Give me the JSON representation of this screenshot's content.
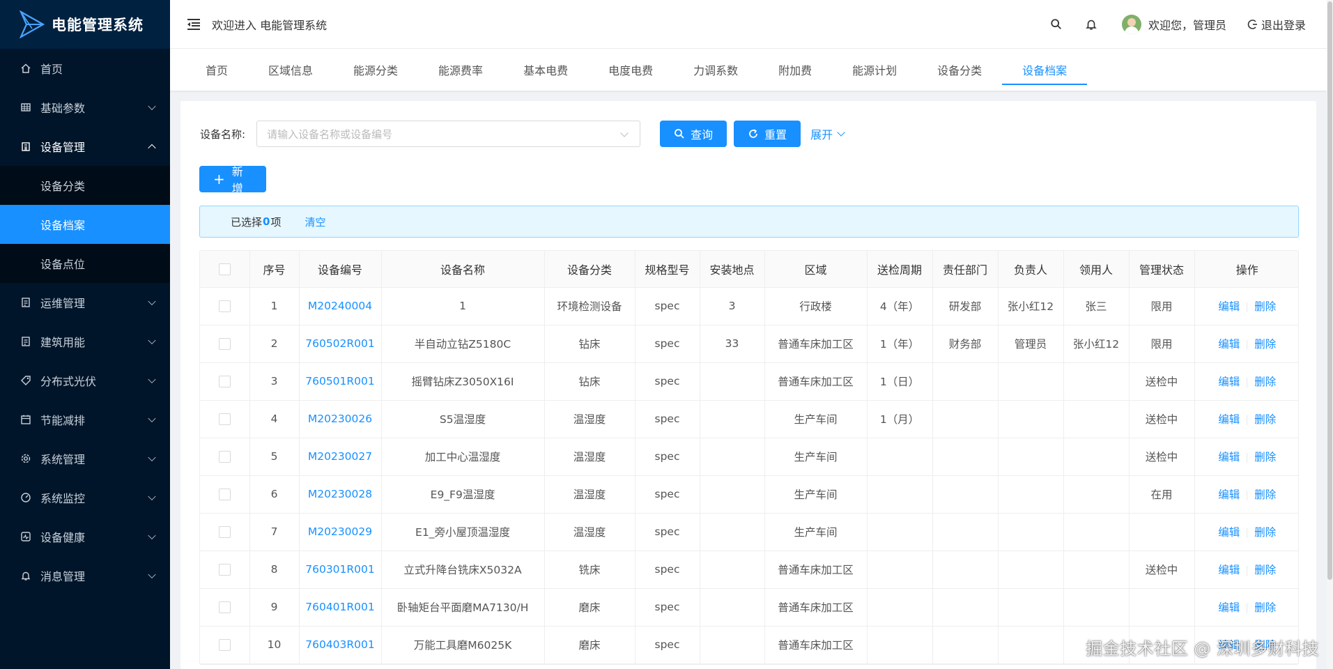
{
  "app": {
    "title": "电能管理系统"
  },
  "sidebar": {
    "items": [
      {
        "label": "首页",
        "icon": "home-icon",
        "has_children": false
      },
      {
        "label": "基础参数",
        "icon": "table-icon",
        "has_children": true
      },
      {
        "label": "设备管理",
        "icon": "building-icon",
        "has_children": true,
        "open": true,
        "children": [
          {
            "label": "设备分类",
            "active": false
          },
          {
            "label": "设备档案",
            "active": true
          },
          {
            "label": "设备点位",
            "active": false
          }
        ]
      },
      {
        "label": "运维管理",
        "icon": "clipboard-icon",
        "has_children": true
      },
      {
        "label": "建筑用能",
        "icon": "clipboard-icon",
        "has_children": true
      },
      {
        "label": "分布式光伏",
        "icon": "tag-icon",
        "has_children": true
      },
      {
        "label": "节能减排",
        "icon": "calendar-icon",
        "has_children": true
      },
      {
        "label": "系统管理",
        "icon": "gear-icon",
        "has_children": true
      },
      {
        "label": "系统监控",
        "icon": "dashboard-icon",
        "has_children": true
      },
      {
        "label": "设备健康",
        "icon": "health-icon",
        "has_children": true
      },
      {
        "label": "消息管理",
        "icon": "bell-icon",
        "has_children": true
      }
    ]
  },
  "header": {
    "welcome": "欢迎进入 电能管理系统",
    "user_greeting": "欢迎您，管理员",
    "logout": "退出登录"
  },
  "tabs": [
    {
      "label": "首页",
      "active": false
    },
    {
      "label": "区域信息",
      "active": false
    },
    {
      "label": "能源分类",
      "active": false
    },
    {
      "label": "能源费率",
      "active": false
    },
    {
      "label": "基本电费",
      "active": false
    },
    {
      "label": "电度电费",
      "active": false
    },
    {
      "label": "力调系数",
      "active": false
    },
    {
      "label": "附加费",
      "active": false
    },
    {
      "label": "能源计划",
      "active": false
    },
    {
      "label": "设备分类",
      "active": false
    },
    {
      "label": "设备档案",
      "active": true
    }
  ],
  "search": {
    "label": "设备名称:",
    "placeholder": "请输入设备名称或设备编号",
    "query": "查询",
    "reset": "重置",
    "expand": "展开"
  },
  "toolbar": {
    "add": "新增"
  },
  "selection": {
    "prefix": "已选择",
    "count": "0",
    "suffix": "项",
    "clear": "清空"
  },
  "table": {
    "columns": [
      "序号",
      "设备编号",
      "设备名称",
      "设备分类",
      "规格型号",
      "安装地点",
      "区域",
      "送检周期",
      "责任部门",
      "负责人",
      "领用人",
      "管理状态",
      "操作"
    ],
    "edit": "编辑",
    "delete": "删除",
    "rows": [
      {
        "no": "1",
        "code": "M20240004",
        "name": "1",
        "category": "环境检测设备",
        "spec": "spec",
        "location": "3",
        "area": "行政楼",
        "cycle": "4（年）",
        "dept": "研发部",
        "owner": "张小红12",
        "user": "张三",
        "status": "限用"
      },
      {
        "no": "2",
        "code": "760502R001",
        "name": "半自动立钻Z5180C",
        "category": "钻床",
        "spec": "spec",
        "location": "33",
        "area": "普通车床加工区",
        "cycle": "1（年）",
        "dept": "财务部",
        "owner": "管理员",
        "user": "张小红12",
        "status": "限用"
      },
      {
        "no": "3",
        "code": "760501R001",
        "name": "摇臂钻床Z3050X16I",
        "category": "钻床",
        "spec": "spec",
        "location": "",
        "area": "普通车床加工区",
        "cycle": "1（日）",
        "dept": "",
        "owner": "",
        "user": "",
        "status": "送检中"
      },
      {
        "no": "4",
        "code": "M20230026",
        "name": "S5温湿度",
        "category": "温湿度",
        "spec": "spec",
        "location": "",
        "area": "生产车间",
        "cycle": "1（月）",
        "dept": "",
        "owner": "",
        "user": "",
        "status": "送检中"
      },
      {
        "no": "5",
        "code": "M20230027",
        "name": "加工中心温湿度",
        "category": "温湿度",
        "spec": "spec",
        "location": "",
        "area": "生产车间",
        "cycle": "",
        "dept": "",
        "owner": "",
        "user": "",
        "status": "送检中"
      },
      {
        "no": "6",
        "code": "M20230028",
        "name": "E9_F9温湿度",
        "category": "温湿度",
        "spec": "spec",
        "location": "",
        "area": "生产车间",
        "cycle": "",
        "dept": "",
        "owner": "",
        "user": "",
        "status": "在用"
      },
      {
        "no": "7",
        "code": "M20230029",
        "name": "E1_旁小屋顶温湿度",
        "category": "温湿度",
        "spec": "spec",
        "location": "",
        "area": "生产车间",
        "cycle": "",
        "dept": "",
        "owner": "",
        "user": "",
        "status": ""
      },
      {
        "no": "8",
        "code": "760301R001",
        "name": "立式升降台铣床X5032A",
        "category": "铣床",
        "spec": "spec",
        "location": "",
        "area": "普通车床加工区",
        "cycle": "",
        "dept": "",
        "owner": "",
        "user": "",
        "status": "送检中"
      },
      {
        "no": "9",
        "code": "760401R001",
        "name": "卧轴矩台平面磨MA7130/H",
        "category": "磨床",
        "spec": "spec",
        "location": "",
        "area": "普通车床加工区",
        "cycle": "",
        "dept": "",
        "owner": "",
        "user": "",
        "status": ""
      },
      {
        "no": "10",
        "code": "760403R001",
        "name": "万能工具磨M6025K",
        "category": "磨床",
        "spec": "spec",
        "location": "",
        "area": "普通车床加工区",
        "cycle": "",
        "dept": "",
        "owner": "",
        "user": "",
        "status": ""
      }
    ]
  },
  "watermark": "掘金技术社区 @ 深圳多财科技",
  "colors": {
    "primary": "#1890ff",
    "sidebar": "#001529",
    "sidebar_sub": "#000c17"
  }
}
